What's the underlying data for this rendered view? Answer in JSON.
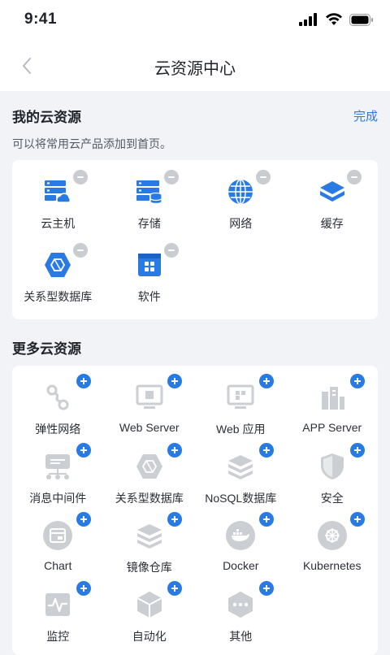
{
  "status": {
    "time": "9:41"
  },
  "nav": {
    "title": "云资源中心"
  },
  "my_resources": {
    "title": "我的云资源",
    "action": "完成",
    "description": "可以将常用云产品添加到首页。",
    "items": [
      {
        "label": "云主机",
        "icon": "cloud-host-icon"
      },
      {
        "label": "存储",
        "icon": "storage-icon"
      },
      {
        "label": "网络",
        "icon": "globe-icon"
      },
      {
        "label": "缓存",
        "icon": "cache-icon"
      },
      {
        "label": "关系型数据库",
        "icon": "relational-db-icon"
      },
      {
        "label": "软件",
        "icon": "software-icon"
      }
    ]
  },
  "more_resources": {
    "title": "更多云资源",
    "items": [
      {
        "label": "弹性网络",
        "icon": "elastic-network-icon"
      },
      {
        "label": "Web Server",
        "icon": "web-server-icon"
      },
      {
        "label": "Web 应用",
        "icon": "web-app-icon"
      },
      {
        "label": "APP Server",
        "icon": "app-server-icon"
      },
      {
        "label": "消息中间件",
        "icon": "message-middleware-icon"
      },
      {
        "label": "关系型数据库",
        "icon": "relational-db-gray-icon"
      },
      {
        "label": "NoSQL数据库",
        "icon": "nosql-db-icon"
      },
      {
        "label": "安全",
        "icon": "security-shield-icon"
      },
      {
        "label": "Chart",
        "icon": "chart-icon"
      },
      {
        "label": "镜像仓库",
        "icon": "image-registry-icon"
      },
      {
        "label": "Docker",
        "icon": "docker-icon"
      },
      {
        "label": "Kubernetes",
        "icon": "kubernetes-icon"
      },
      {
        "label": "监控",
        "icon": "monitor-icon"
      },
      {
        "label": "自动化",
        "icon": "automation-icon"
      },
      {
        "label": "其他",
        "icon": "more-dots-icon"
      }
    ]
  },
  "colors": {
    "accent": "#2a7ae4",
    "remove_badge": "#c9ccd1",
    "icon_gray": "#cbced3",
    "background": "#f1f3f7"
  }
}
